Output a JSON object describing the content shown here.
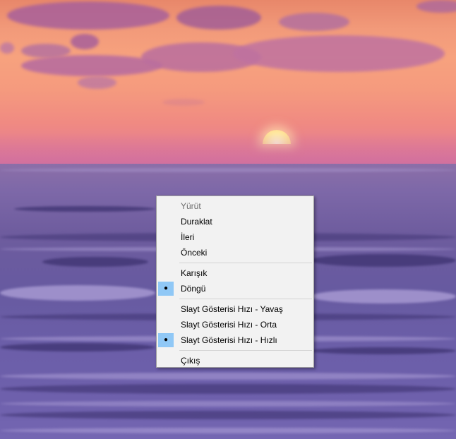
{
  "desktop": {
    "background": "sunset-over-ocean"
  },
  "context_menu": {
    "groups": [
      {
        "items": [
          {
            "label": "Yürüt",
            "enabled": false,
            "checked": false
          },
          {
            "label": "Duraklat",
            "enabled": true,
            "checked": false
          },
          {
            "label": "İleri",
            "enabled": true,
            "checked": false
          },
          {
            "label": "Önceki",
            "enabled": true,
            "checked": false
          }
        ]
      },
      {
        "items": [
          {
            "label": "Karışık",
            "enabled": true,
            "checked": false
          },
          {
            "label": "Döngü",
            "enabled": true,
            "checked": true
          }
        ]
      },
      {
        "items": [
          {
            "label": "Slayt Gösterisi Hızı - Yavaş",
            "enabled": true,
            "checked": false
          },
          {
            "label": "Slayt Gösterisi Hızı - Orta",
            "enabled": true,
            "checked": false
          },
          {
            "label": "Slayt Gösterisi Hızı - Hızlı",
            "enabled": true,
            "checked": true
          }
        ]
      },
      {
        "items": [
          {
            "label": "Çıkış",
            "enabled": true,
            "checked": false
          }
        ]
      }
    ],
    "check_glyph": "●",
    "colors": {
      "menu_background": "#f2f2f2",
      "menu_border": "#a0a0a0",
      "check_highlight": "#90c8f6",
      "disabled_text": "#6d6d6d"
    }
  }
}
